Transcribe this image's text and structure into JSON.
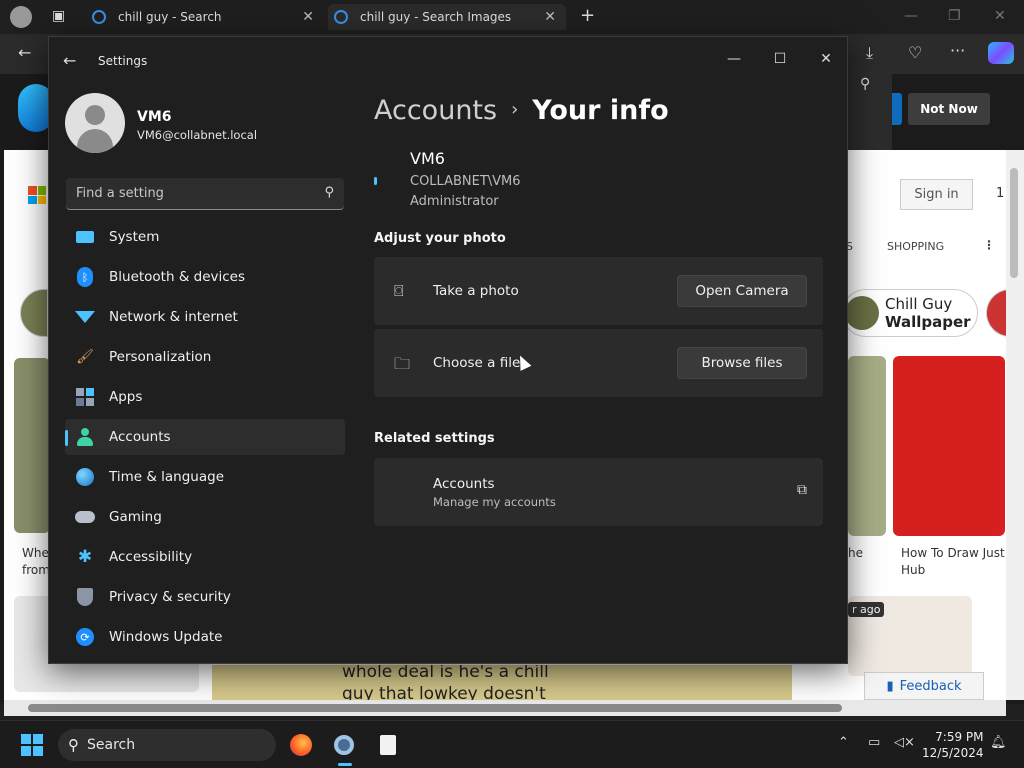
{
  "browser": {
    "tabs": [
      {
        "title": "chill guy - Search"
      },
      {
        "title": "chill guy - Search Images"
      }
    ],
    "notnow_label": "Not Now",
    "signin_label": "Sign in",
    "web_number": "1",
    "shopping_label": "SHOPPING",
    "partial_letter": "S",
    "chill_pill": {
      "line1": "Chill Guy",
      "line2": "Wallpaper"
    },
    "captions": {
      "left": "Whe from",
      "middle": "he",
      "right": "How To Draw Just Hub"
    },
    "time_badge": "r ago",
    "meme_text": "whole deal is he's a chill guy that lowkey doesn't",
    "feedback_label": "Feedback"
  },
  "settings": {
    "app_title": "Settings",
    "profile": {
      "name": "VM6",
      "email": "VM6@collabnet.local"
    },
    "search_placeholder": "Find a setting",
    "nav": [
      {
        "label": "System",
        "icon": "system-icon"
      },
      {
        "label": "Bluetooth & devices",
        "icon": "bluetooth-icon"
      },
      {
        "label": "Network & internet",
        "icon": "network-icon"
      },
      {
        "label": "Personalization",
        "icon": "brush-icon"
      },
      {
        "label": "Apps",
        "icon": "apps-icon"
      },
      {
        "label": "Accounts",
        "icon": "accounts-icon",
        "selected": true
      },
      {
        "label": "Time & language",
        "icon": "globe-clock-icon"
      },
      {
        "label": "Gaming",
        "icon": "gamepad-icon"
      },
      {
        "label": "Accessibility",
        "icon": "accessibility-icon"
      },
      {
        "label": "Privacy & security",
        "icon": "shield-icon"
      },
      {
        "label": "Windows Update",
        "icon": "update-icon"
      }
    ],
    "breadcrumb": {
      "parent": "Accounts",
      "current": "Your info"
    },
    "user": {
      "name": "VM6",
      "domain": "COLLABNET\\VM6",
      "role": "Administrator"
    },
    "adjust_photo": {
      "heading": "Adjust your photo",
      "take_photo": {
        "label": "Take a photo",
        "button": "Open Camera"
      },
      "choose_file": {
        "label": "Choose a file",
        "button": "Browse files"
      }
    },
    "related": {
      "heading": "Related settings",
      "accounts": {
        "title": "Accounts",
        "subtitle": "Manage my accounts"
      }
    }
  },
  "taskbar": {
    "search_label": "Search",
    "time": "7:59 PM",
    "date": "12/5/2024"
  },
  "colors": {
    "accent": "#4cc2ff",
    "window_bg": "#1f1f1f",
    "card_bg": "#2b2b2b"
  }
}
